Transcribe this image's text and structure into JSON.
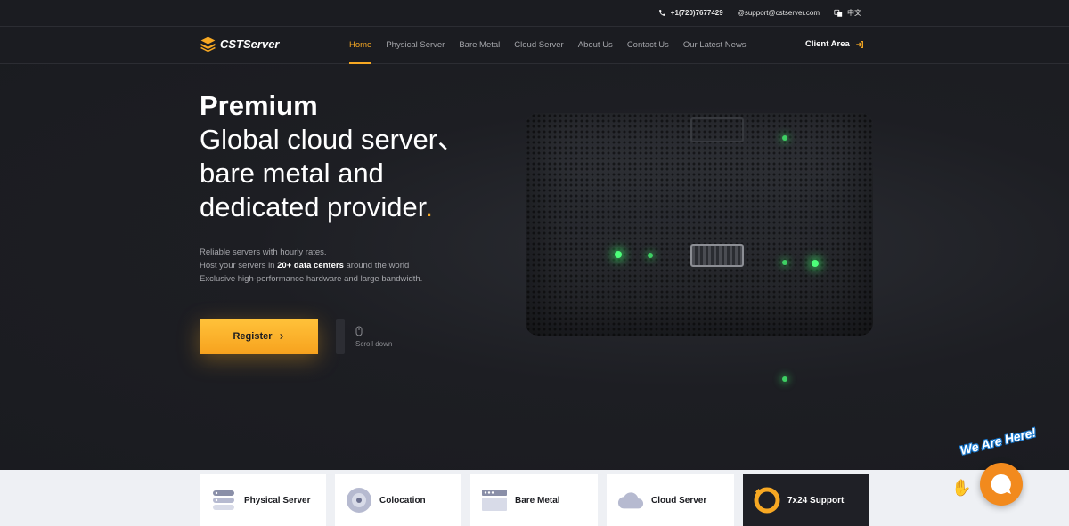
{
  "topbar": {
    "phone": "+1(720)7677429",
    "email": "@support@cstserver.com",
    "language": "中文"
  },
  "brand": {
    "name": "CSTServer",
    "color": "#f7a823"
  },
  "nav": {
    "items": [
      {
        "label": "Home",
        "active": true
      },
      {
        "label": "Physical Server",
        "active": false
      },
      {
        "label": "Bare Metal",
        "active": false
      },
      {
        "label": "Cloud Server",
        "active": false
      },
      {
        "label": "About Us",
        "active": false
      },
      {
        "label": "Contact Us",
        "active": false
      },
      {
        "label": "Our Latest News",
        "active": false
      }
    ],
    "client_area": "Client Area"
  },
  "hero": {
    "title_strong": "Premium",
    "title_line1": "Global cloud server、",
    "title_line2": "bare metal and",
    "title_line3": "dedicated provider",
    "title_dot": ".",
    "desc_line1": "Reliable servers with hourly rates.",
    "desc_line2_pre": "Host your servers in ",
    "desc_line2_bold": "20+ data centers",
    "desc_line2_post": " around the world",
    "desc_line3": "Exclusive high-performance hardware and large bandwidth.",
    "register_label": "Register",
    "scroll_label": "Scroll down"
  },
  "features": [
    {
      "label": "Physical Server",
      "icon": "server-stack-icon"
    },
    {
      "label": "Colocation",
      "icon": "disc-icon"
    },
    {
      "label": "Bare Metal",
      "icon": "window-icon"
    },
    {
      "label": "Cloud Server",
      "icon": "cloud-icon"
    },
    {
      "label": "7x24 Support",
      "icon": "lifebuoy-icon"
    }
  ],
  "chat": {
    "banner": "We Are Here!"
  }
}
